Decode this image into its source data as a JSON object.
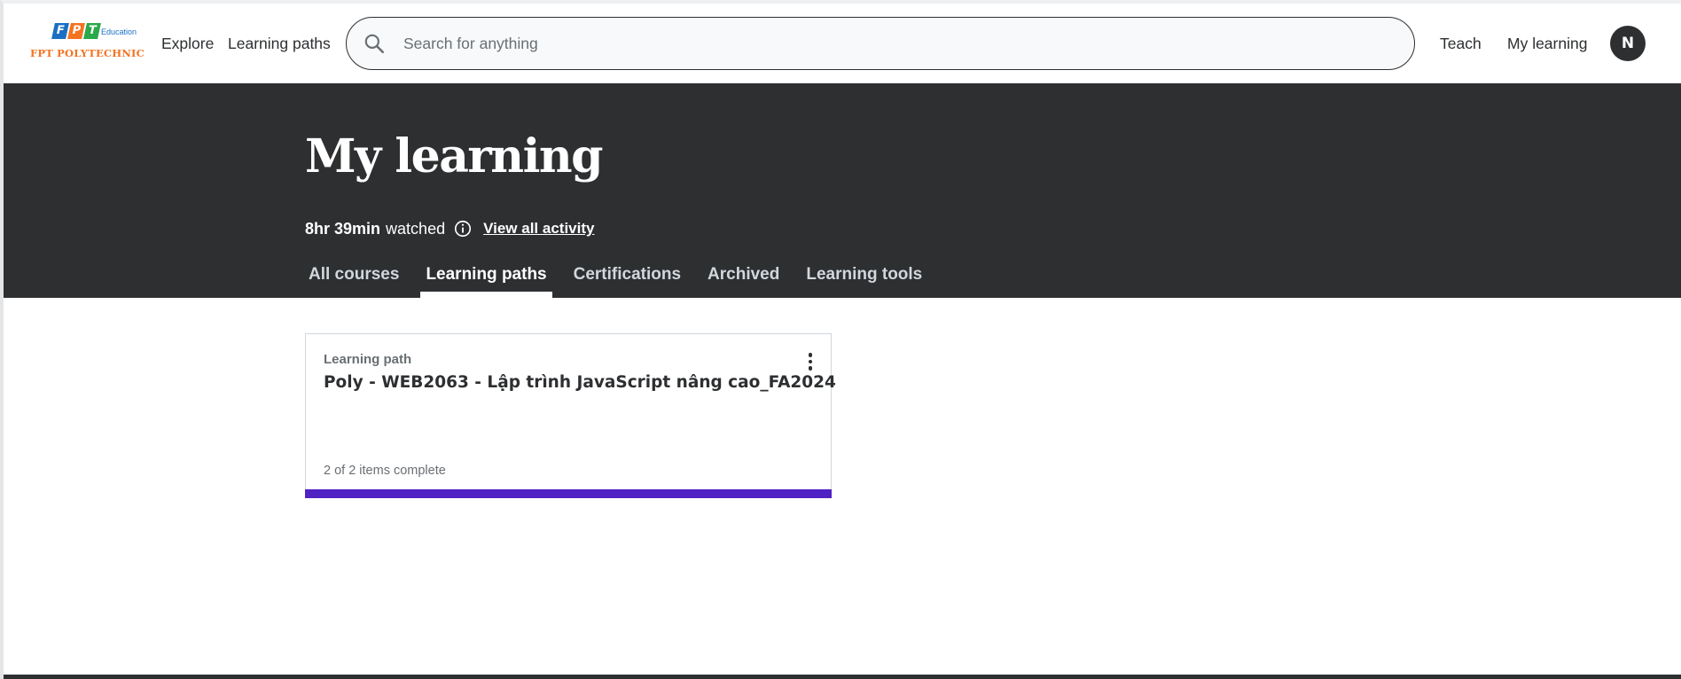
{
  "header": {
    "logo": {
      "letters": [
        "F",
        "P",
        "T"
      ],
      "edu_text": "Education",
      "name": "FPT POLYTECHNIC"
    },
    "nav": {
      "explore": "Explore",
      "learning_paths": "Learning paths",
      "teach": "Teach",
      "my_learning": "My learning"
    },
    "search": {
      "placeholder": "Search for anything",
      "value": "",
      "icon": "search-icon"
    },
    "avatar_initial": "N"
  },
  "hero": {
    "title": "My learning",
    "watched_hours": "8hr 39min",
    "watched_label": "watched",
    "info_icon": "info-icon",
    "activity_link": "View all activity",
    "tabs": [
      {
        "label": "All courses",
        "active": false
      },
      {
        "label": "Learning paths",
        "active": true
      },
      {
        "label": "Certifications",
        "active": false
      },
      {
        "label": "Archived",
        "active": false
      },
      {
        "label": "Learning tools",
        "active": false
      }
    ]
  },
  "cards": [
    {
      "kind": "Learning path",
      "title": "Poly - WEB2063 - Lập trình JavaScript nâng cao_FA2024",
      "progress_text": "2 of 2 items complete",
      "progress": 1.0,
      "menu_icon": "more-vertical-icon"
    }
  ],
  "colors": {
    "header_bg": "#ffffff",
    "band_bg": "#2d2f31",
    "progress": "#5022c3",
    "text": "#2d2f31",
    "muted": "#6a6f73"
  }
}
